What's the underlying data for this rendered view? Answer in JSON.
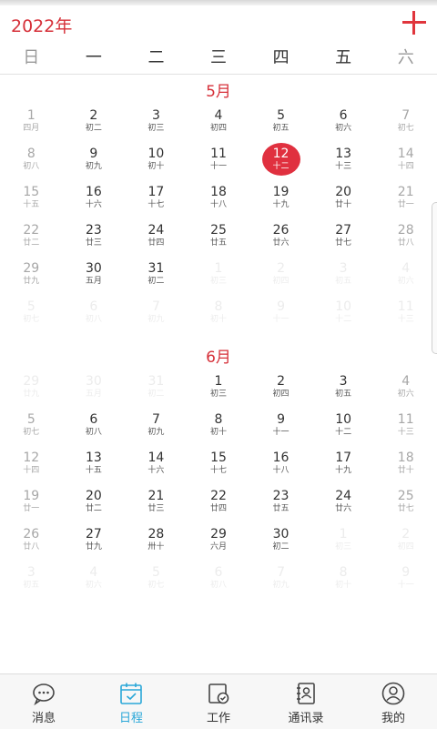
{
  "header": {
    "year_label": "2022年"
  },
  "weekdays": [
    "日",
    "一",
    "二",
    "三",
    "四",
    "五",
    "六"
  ],
  "months": [
    {
      "title": "5月",
      "cells": [
        {
          "num": "1",
          "lunar": "四月",
          "type": "weekend"
        },
        {
          "num": "2",
          "lunar": "初二",
          "type": "normal"
        },
        {
          "num": "3",
          "lunar": "初三",
          "type": "normal"
        },
        {
          "num": "4",
          "lunar": "初四",
          "type": "normal"
        },
        {
          "num": "5",
          "lunar": "初五",
          "type": "normal"
        },
        {
          "num": "6",
          "lunar": "初六",
          "type": "normal"
        },
        {
          "num": "7",
          "lunar": "初七",
          "type": "weekend"
        },
        {
          "num": "8",
          "lunar": "初八",
          "type": "weekend"
        },
        {
          "num": "9",
          "lunar": "初九",
          "type": "normal"
        },
        {
          "num": "10",
          "lunar": "初十",
          "type": "normal"
        },
        {
          "num": "11",
          "lunar": "十一",
          "type": "normal"
        },
        {
          "num": "12",
          "lunar": "十二",
          "type": "today"
        },
        {
          "num": "13",
          "lunar": "十三",
          "type": "normal"
        },
        {
          "num": "14",
          "lunar": "十四",
          "type": "weekend"
        },
        {
          "num": "15",
          "lunar": "十五",
          "type": "weekend"
        },
        {
          "num": "16",
          "lunar": "十六",
          "type": "normal"
        },
        {
          "num": "17",
          "lunar": "十七",
          "type": "normal"
        },
        {
          "num": "18",
          "lunar": "十八",
          "type": "normal"
        },
        {
          "num": "19",
          "lunar": "十九",
          "type": "normal"
        },
        {
          "num": "20",
          "lunar": "廿十",
          "type": "normal"
        },
        {
          "num": "21",
          "lunar": "廿一",
          "type": "weekend"
        },
        {
          "num": "22",
          "lunar": "廿二",
          "type": "weekend"
        },
        {
          "num": "23",
          "lunar": "廿三",
          "type": "normal"
        },
        {
          "num": "24",
          "lunar": "廿四",
          "type": "normal"
        },
        {
          "num": "25",
          "lunar": "廿五",
          "type": "normal"
        },
        {
          "num": "26",
          "lunar": "廿六",
          "type": "normal"
        },
        {
          "num": "27",
          "lunar": "廿七",
          "type": "normal"
        },
        {
          "num": "28",
          "lunar": "廿八",
          "type": "weekend"
        },
        {
          "num": "29",
          "lunar": "廿九",
          "type": "weekend"
        },
        {
          "num": "30",
          "lunar": "五月",
          "type": "normal"
        },
        {
          "num": "31",
          "lunar": "初二",
          "type": "normal"
        },
        {
          "num": "1",
          "lunar": "初三",
          "type": "other"
        },
        {
          "num": "2",
          "lunar": "初四",
          "type": "other"
        },
        {
          "num": "3",
          "lunar": "初五",
          "type": "other"
        },
        {
          "num": "4",
          "lunar": "初六",
          "type": "other"
        },
        {
          "num": "5",
          "lunar": "初七",
          "type": "other"
        },
        {
          "num": "6",
          "lunar": "初八",
          "type": "other"
        },
        {
          "num": "7",
          "lunar": "初九",
          "type": "other"
        },
        {
          "num": "8",
          "lunar": "初十",
          "type": "other"
        },
        {
          "num": "9",
          "lunar": "十一",
          "type": "other"
        },
        {
          "num": "10",
          "lunar": "十二",
          "type": "other"
        },
        {
          "num": "11",
          "lunar": "十三",
          "type": "other"
        }
      ]
    },
    {
      "title": "6月",
      "cells": [
        {
          "num": "29",
          "lunar": "廿九",
          "type": "other"
        },
        {
          "num": "30",
          "lunar": "五月",
          "type": "other"
        },
        {
          "num": "31",
          "lunar": "初二",
          "type": "other"
        },
        {
          "num": "1",
          "lunar": "初三",
          "type": "normal"
        },
        {
          "num": "2",
          "lunar": "初四",
          "type": "normal"
        },
        {
          "num": "3",
          "lunar": "初五",
          "type": "normal"
        },
        {
          "num": "4",
          "lunar": "初六",
          "type": "weekend"
        },
        {
          "num": "5",
          "lunar": "初七",
          "type": "weekend"
        },
        {
          "num": "6",
          "lunar": "初八",
          "type": "normal"
        },
        {
          "num": "7",
          "lunar": "初九",
          "type": "normal"
        },
        {
          "num": "8",
          "lunar": "初十",
          "type": "normal"
        },
        {
          "num": "9",
          "lunar": "十一",
          "type": "normal"
        },
        {
          "num": "10",
          "lunar": "十二",
          "type": "normal"
        },
        {
          "num": "11",
          "lunar": "十三",
          "type": "weekend"
        },
        {
          "num": "12",
          "lunar": "十四",
          "type": "weekend"
        },
        {
          "num": "13",
          "lunar": "十五",
          "type": "normal"
        },
        {
          "num": "14",
          "lunar": "十六",
          "type": "normal"
        },
        {
          "num": "15",
          "lunar": "十七",
          "type": "normal"
        },
        {
          "num": "16",
          "lunar": "十八",
          "type": "normal"
        },
        {
          "num": "17",
          "lunar": "十九",
          "type": "normal"
        },
        {
          "num": "18",
          "lunar": "廿十",
          "type": "weekend"
        },
        {
          "num": "19",
          "lunar": "廿一",
          "type": "weekend"
        },
        {
          "num": "20",
          "lunar": "廿二",
          "type": "normal"
        },
        {
          "num": "21",
          "lunar": "廿三",
          "type": "normal"
        },
        {
          "num": "22",
          "lunar": "廿四",
          "type": "normal"
        },
        {
          "num": "23",
          "lunar": "廿五",
          "type": "normal"
        },
        {
          "num": "24",
          "lunar": "廿六",
          "type": "normal"
        },
        {
          "num": "25",
          "lunar": "廿七",
          "type": "weekend"
        },
        {
          "num": "26",
          "lunar": "廿八",
          "type": "weekend"
        },
        {
          "num": "27",
          "lunar": "廿九",
          "type": "normal"
        },
        {
          "num": "28",
          "lunar": "卅十",
          "type": "normal"
        },
        {
          "num": "29",
          "lunar": "六月",
          "type": "normal"
        },
        {
          "num": "30",
          "lunar": "初二",
          "type": "normal"
        },
        {
          "num": "1",
          "lunar": "初三",
          "type": "other"
        },
        {
          "num": "2",
          "lunar": "初四",
          "type": "other"
        },
        {
          "num": "3",
          "lunar": "初五",
          "type": "other"
        },
        {
          "num": "4",
          "lunar": "初六",
          "type": "other"
        },
        {
          "num": "5",
          "lunar": "初七",
          "type": "other"
        },
        {
          "num": "6",
          "lunar": "初八",
          "type": "other"
        },
        {
          "num": "7",
          "lunar": "初九",
          "type": "other"
        },
        {
          "num": "8",
          "lunar": "初十",
          "type": "other"
        },
        {
          "num": "9",
          "lunar": "十一",
          "type": "other"
        }
      ]
    }
  ],
  "tabs": [
    {
      "label": "消息",
      "icon": "message-icon",
      "active": false
    },
    {
      "label": "日程",
      "icon": "calendar-icon",
      "active": true
    },
    {
      "label": "工作",
      "icon": "work-icon",
      "active": false
    },
    {
      "label": "通讯录",
      "icon": "contacts-icon",
      "active": false
    },
    {
      "label": "我的",
      "icon": "profile-icon",
      "active": false
    }
  ],
  "colors": {
    "accent": "#d6313a",
    "today_bg": "#e0303f",
    "tab_active": "#2aa7d8"
  }
}
